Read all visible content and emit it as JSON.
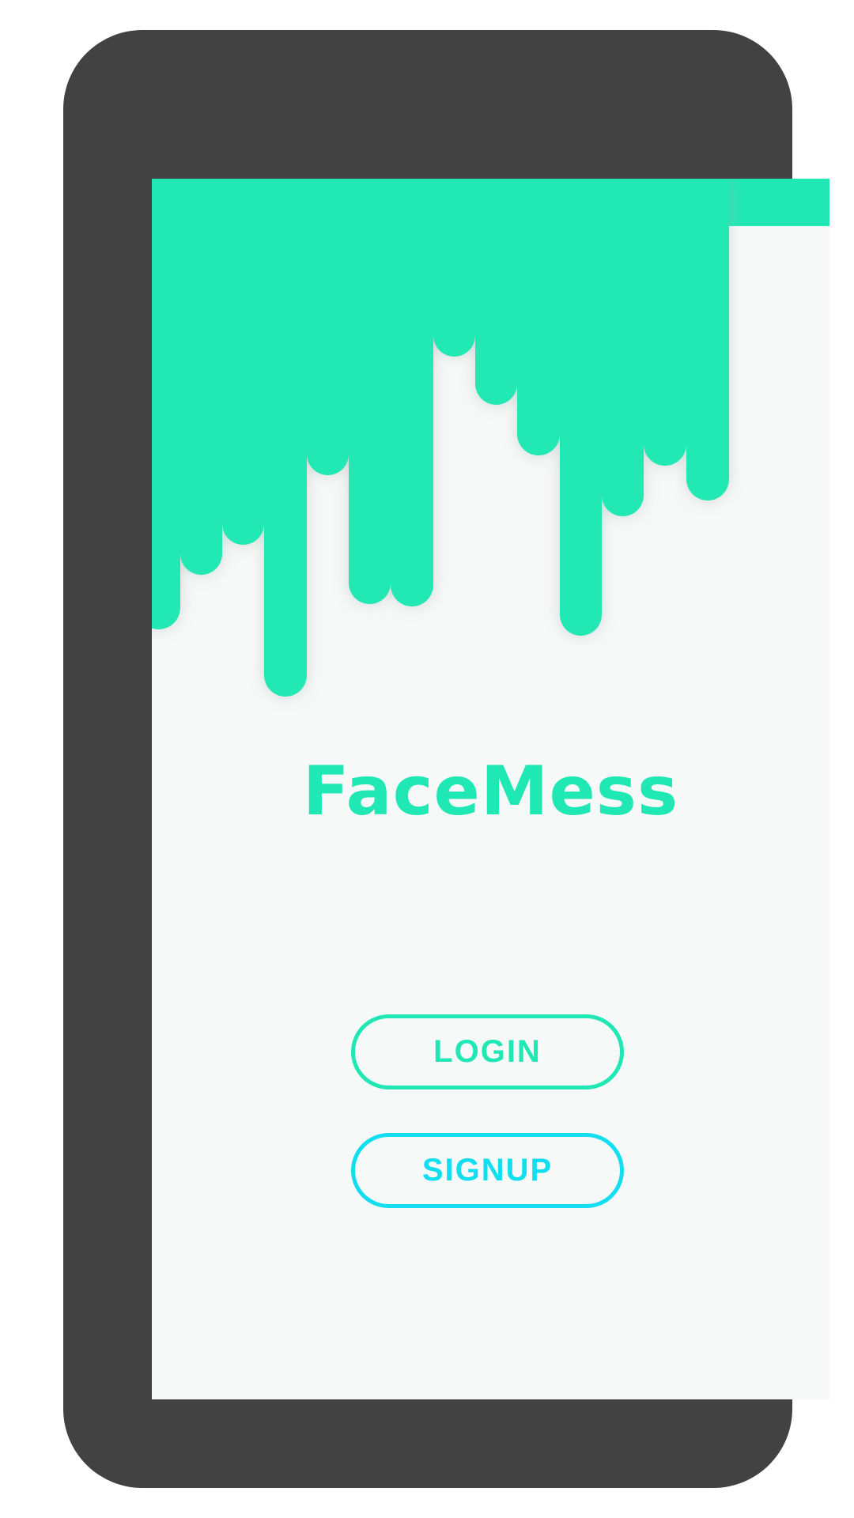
{
  "app": {
    "title": "FaceMess"
  },
  "buttons": {
    "login_label": "LOGIN",
    "signup_label": "SIGNUP"
  },
  "colors": {
    "accent": "#20e8b4",
    "secondary": "#12def0",
    "screen_background": "#f7f8f8",
    "device_frame": "#424242"
  },
  "decoration": {
    "header_graphic": "green-drips"
  }
}
